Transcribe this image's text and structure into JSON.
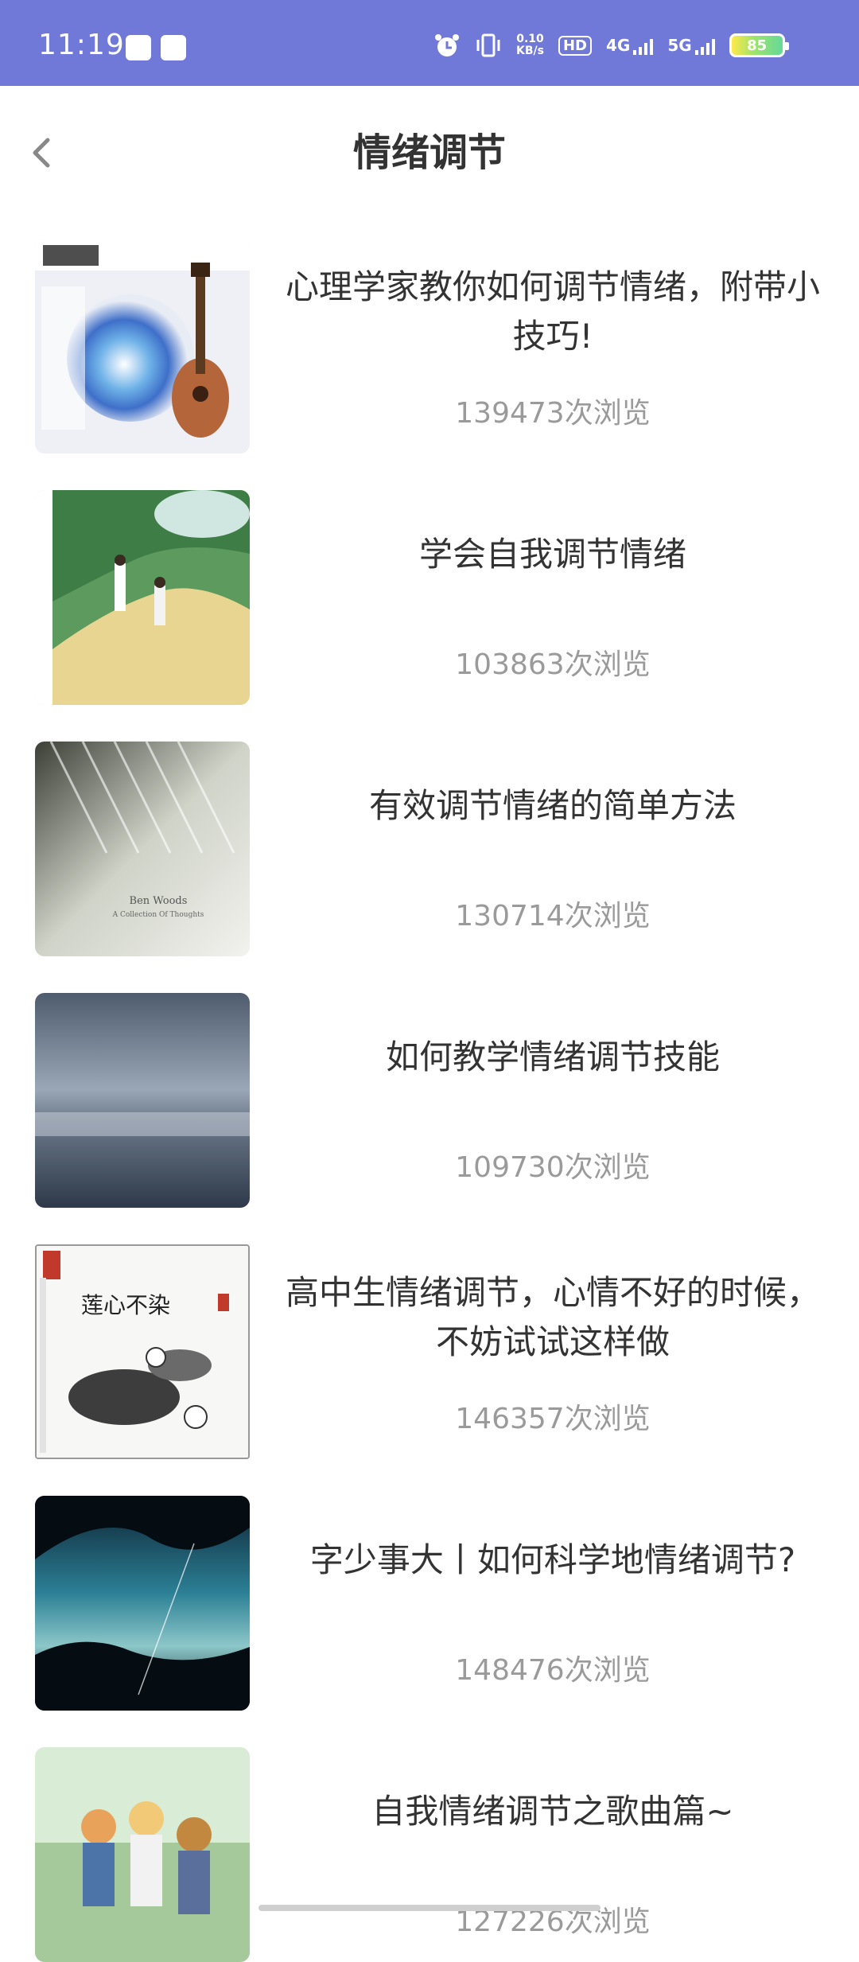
{
  "status_bar": {
    "time": "11:19",
    "net_speed_top": "0.10",
    "net_speed_bottom": "KB/s",
    "hd_label": "HD",
    "net_4g": "4G",
    "net_5g": "5G",
    "battery": "85",
    "icons": [
      "alipay-icon",
      "app-icon",
      "alarm-icon",
      "vibrate-icon",
      "hd-icon",
      "signal-4g-icon",
      "signal-5g-icon",
      "battery-icon"
    ]
  },
  "header": {
    "title": "情绪调节",
    "back_icon": "chevron-left-icon"
  },
  "articles": [
    {
      "title": "心理学家教你如何调节情绪，附带小技巧!",
      "views": "139473次浏览",
      "thumb": "guitar-album-cover"
    },
    {
      "title": "学会自我调节情绪",
      "views": "103863次浏览",
      "thumb": "walking-couple-cover"
    },
    {
      "title": "有效调节情绪的简单方法",
      "views": "130714次浏览",
      "thumb": "piano-cover",
      "thumb_text_1": "Ben Woods",
      "thumb_text_2": "A Collection Of Thoughts"
    },
    {
      "title": "如何教学情绪调节技能",
      "views": "109730次浏览",
      "thumb": "misty-lake-cover"
    },
    {
      "title": "高中生情绪调节，心情不好的时候，不妨试试这样做",
      "views": "146357次浏览",
      "thumb": "lotus-ink-cover",
      "thumb_text_1": "莲心不染"
    },
    {
      "title": "字少事大丨如何科学地情绪调节?",
      "views": "148476次浏览",
      "thumb": "forest-sky-cover"
    },
    {
      "title": "自我情绪调节之歌曲篇~",
      "views": "127226次浏览",
      "thumb": "anime-cover"
    }
  ],
  "colors": {
    "status_bar": "#7079d8",
    "title_text": "#333333",
    "views_text": "#9a9a9a"
  }
}
